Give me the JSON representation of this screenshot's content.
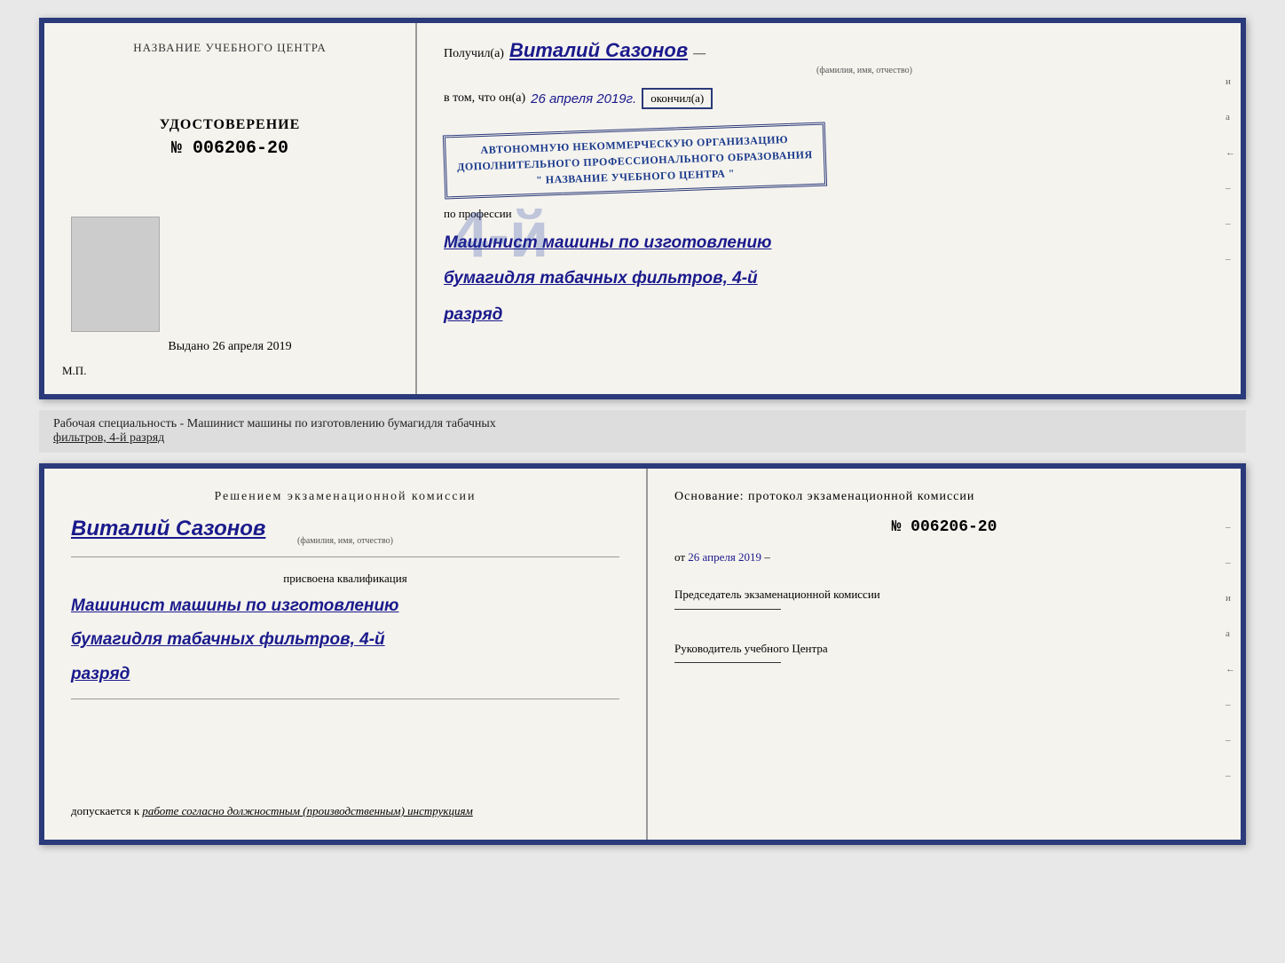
{
  "top_cert": {
    "left": {
      "section_title": "НАЗВАНИЕ УЧЕБНОГО ЦЕНТРА",
      "udostoverenie": "УДОСТОВЕРЕНИЕ",
      "number": "№ 006206-20",
      "vydano": "Выдано 26 апреля 2019",
      "mp": "М.П."
    },
    "right": {
      "poluchil_label": "Получил(а)",
      "fio_handwritten": "Виталий Сазонов",
      "fio_sub": "(фамилия, имя, отчество)",
      "dash1": "—",
      "vtom_label": "в том, что он(а)",
      "date_handwritten": "26 апреля 2019г.",
      "okonchil_label": "окончил(а)",
      "big_number": "4-й",
      "stamp_line1": "АВТОНОМНУЮ НЕКОММЕРЧЕСКУЮ ОРГАНИЗАЦИЮ",
      "stamp_line2": "ДОПОЛНИТЕЛЬНОГО ПРОФЕССИОНАЛЬНОГО ОБРАЗОВАНИЯ",
      "stamp_line3": "\" НАЗВАНИЕ УЧЕБНОГО ЦЕНТРА \"",
      "i_label": "и",
      "a_label": "а",
      "arrow_label": "←",
      "professiya_label": "по профессии",
      "prof_handwritten_1": "Машинист машины по изготовлению",
      "prof_handwritten_2": "бумагидля табачных фильтров, 4-й",
      "prof_handwritten_3": "разряд"
    }
  },
  "middle": {
    "text_part1": "Рабочая специальность - Машинист машины по изготовлению бумагидля табачных",
    "text_part2_underline": "фильтров, 4-й разряд"
  },
  "bottom_cert": {
    "left": {
      "resheniem": "Решением  экзаменационной  комиссии",
      "fio_handwritten": "Виталий Сазонов",
      "fio_sub": "(фамилия, имя, отчество)",
      "prisvoena": "присвоена квалификация",
      "qual_1": "Машинист машины по изготовлению",
      "qual_2": "бумагидля табачных фильтров, 4-й",
      "qual_3": "разряд",
      "dopuskaetsya_label": "допускается к",
      "dopuskaetsya_italic": "работе согласно должностным (производственным) инструкциям"
    },
    "right": {
      "osnov_label": "Основание: протокол экзаменационной  комиссии",
      "number": "№  006206-20",
      "ot_label": "от",
      "ot_date": "26 апреля 2019",
      "predsedatel_label": "Председатель экзаменационной комиссии",
      "rukov_label": "Руководитель учебного Центра",
      "i_label": "и",
      "a_label": "а",
      "arrow_label": "←"
    }
  }
}
